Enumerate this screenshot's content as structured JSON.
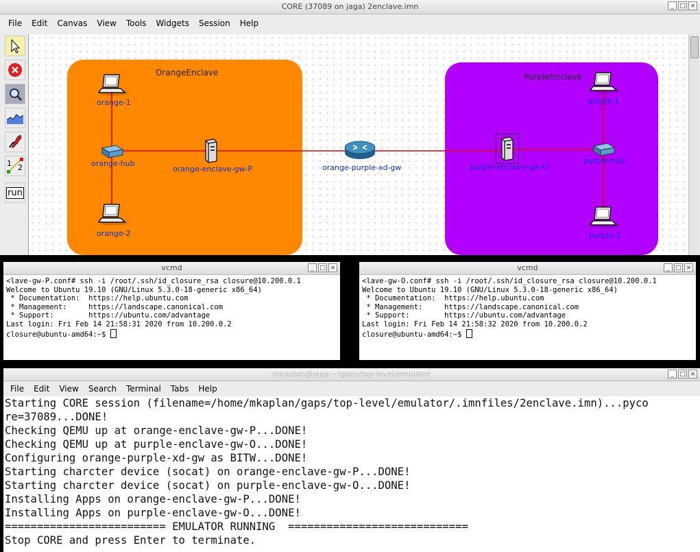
{
  "core": {
    "title": "CORE (37089 on jaga) 2enclave.imn",
    "menu": [
      "File",
      "Edit",
      "Canvas",
      "View",
      "Tools",
      "Widgets",
      "Session",
      "Help"
    ],
    "tools": [
      "select-tool",
      "stop-session-tool",
      "observer-tool",
      "plot-tool",
      "marker-tool",
      "two-node-tool",
      "run-tool"
    ],
    "run_label": "run",
    "two_node_labels": [
      "1",
      "2"
    ],
    "enclaves": [
      {
        "name": "OrangeEnclave",
        "color": "#ff8800"
      },
      {
        "name": "PurpleEnclave",
        "color": "#b200ff"
      }
    ],
    "nodes": {
      "orange_1": "orange-1",
      "orange_hub": "orange-hub",
      "orange_2": "orange-2",
      "orange_gw": "orange-enclave-gw-P",
      "xd_gw": "orange-purple-xd-gw",
      "purple_gw": "purple-enclave-gw-O",
      "purple_1": "purple-1",
      "purple_hub": "purple-hub",
      "purple_2": "purple-2"
    },
    "link_color": "#e00000"
  },
  "vcmd_left": {
    "title": "vcmd",
    "lines": [
      "<lave-gw-P.conf# ssh -i /root/.ssh/id_closure_rsa closure@10.200.0.1",
      "Welcome to Ubuntu 19.10 (GNU/Linux 5.3.0-18-generic x86_64)",
      "",
      " * Documentation:  https://help.ubuntu.com",
      " * Management:     https://landscape.canonical.com",
      " * Support:        https://ubuntu.com/advantage",
      "",
      "Last login: Fri Feb 14 21:58:31 2020 from 10.200.0.2",
      "closure@ubuntu-amd64:~$ "
    ]
  },
  "vcmd_right": {
    "title": "vcmd",
    "lines": [
      "<lave-gw-O.conf# ssh -i /root/.ssh/id_closure_rsa closure@10.200.0.1",
      "Welcome to Ubuntu 19.10 (GNU/Linux 5.3.0-18-generic x86_64)",
      "",
      " * Documentation:  https://help.ubuntu.com",
      " * Management:     https://landscape.canonical.com",
      " * Support:        https://ubuntu.com/advantage",
      "",
      "Last login: Fri Feb 14 21:58:32 2020 from 10.200.0.2",
      "closure@ubuntu-amd64:~$ "
    ]
  },
  "terminal": {
    "title": "mkaplan@jaga:~/gaps/top-level/emulator",
    "menu": [
      "File",
      "Edit",
      "View",
      "Search",
      "Terminal",
      "Tabs",
      "Help"
    ],
    "lines": [
      "Starting CORE session (filename=/home/mkaplan/gaps/top-level/emulator/.imnfiles/2enclave.imn)...pyco",
      "re=37089...DONE!",
      "Checking QEMU up at orange-enclave-gw-P...DONE!",
      "Checking QEMU up at purple-enclave-gw-O...DONE!",
      "Configuring orange-purple-xd-gw as BITW...DONE!",
      "Starting charcter device (socat) on orange-enclave-gw-P...DONE!",
      "Starting charcter device (socat) on purple-enclave-gw-O...DONE!",
      "Installing Apps on orange-enclave-gw-P...DONE!",
      "Installing Apps on purple-enclave-gw-O...DONE!",
      "========================= EMULATOR RUNNING  ============================",
      "Stop CORE and press Enter to terminate."
    ]
  },
  "window_buttons": {
    "minimize": "_",
    "maximize": "□",
    "close": "×"
  }
}
